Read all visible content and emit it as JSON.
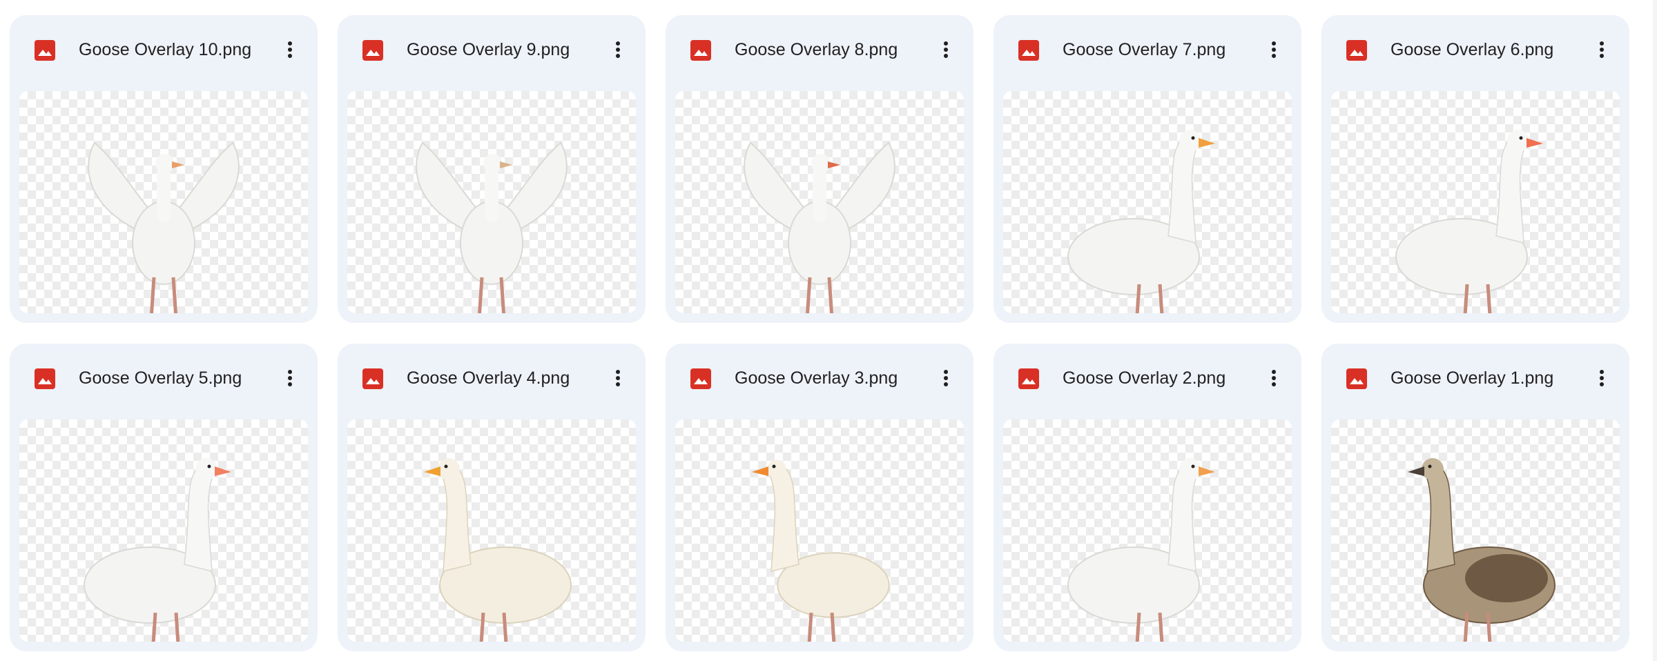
{
  "files": [
    {
      "name": "Goose Overlay 10.png",
      "pose": "wings-up",
      "tone": "white",
      "beak": "#e8a06a",
      "icon": "image-icon"
    },
    {
      "name": "Goose Overlay 9.png",
      "pose": "wings-up-front",
      "tone": "white",
      "beak": "#d9b48a",
      "icon": "image-icon"
    },
    {
      "name": "Goose Overlay 8.png",
      "pose": "wings-up-tall",
      "tone": "white",
      "beak": "#e06a4a",
      "icon": "image-icon"
    },
    {
      "name": "Goose Overlay 7.png",
      "pose": "standing-right",
      "tone": "white",
      "beak": "#f0a040",
      "icon": "image-icon"
    },
    {
      "name": "Goose Overlay 6.png",
      "pose": "standing-right",
      "tone": "white",
      "beak": "#f07050",
      "icon": "image-icon"
    },
    {
      "name": "Goose Overlay 5.png",
      "pose": "standing-right",
      "tone": "white",
      "beak": "#f08060",
      "icon": "image-icon"
    },
    {
      "name": "Goose Overlay 4.png",
      "pose": "standing-left",
      "tone": "cream",
      "beak": "#f0a030",
      "icon": "image-icon"
    },
    {
      "name": "Goose Overlay 3.png",
      "pose": "standing-left-small",
      "tone": "cream",
      "beak": "#f08a30",
      "icon": "image-icon"
    },
    {
      "name": "Goose Overlay 2.png",
      "pose": "standing-right",
      "tone": "white",
      "beak": "#f0a050",
      "icon": "image-icon"
    },
    {
      "name": "Goose Overlay 1.png",
      "pose": "standing-left-brown",
      "tone": "brown",
      "beak": "#4a4038",
      "icon": "image-icon"
    }
  ],
  "colors": {
    "card_bg": "#eef2f9",
    "icon_red": "#d93025",
    "text": "#1f1f1f"
  },
  "menu_icon": "more-vert-icon"
}
